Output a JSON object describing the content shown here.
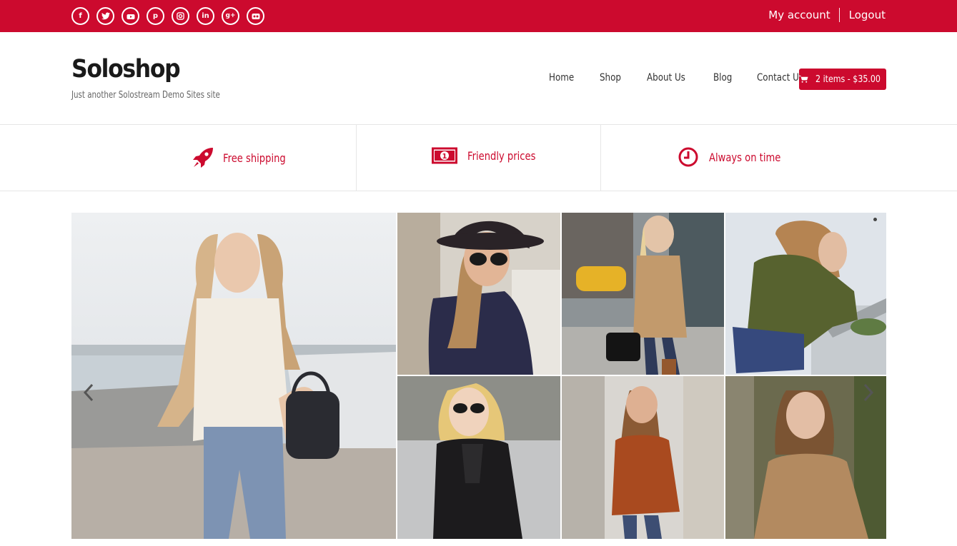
{
  "topbar": {
    "social_icons": [
      "facebook-icon",
      "twitter-icon",
      "youtube-icon",
      "pinterest-icon",
      "instagram-icon",
      "linkedin-icon",
      "google-plus-icon",
      "flickr-icon"
    ],
    "my_account": "My account",
    "logout": "Logout"
  },
  "brand": {
    "title": "Soloshop",
    "tagline": "Just another Solostream Demo Sites site"
  },
  "nav": {
    "items": [
      "Home",
      "Shop",
      "About Us",
      "Blog",
      "Contact Us"
    ]
  },
  "cart": {
    "label": "2 items - $35.00",
    "icon": "cart-icon"
  },
  "features": [
    {
      "icon": "rocket-icon",
      "label": "Free shipping"
    },
    {
      "icon": "money-icon",
      "label": "Friendly prices"
    },
    {
      "icon": "clock-icon",
      "label": "Always on time"
    }
  ],
  "gallery": {
    "slides": [
      "woman-lace-top-photo",
      "woman-black-hat-photo",
      "woman-camel-coat-photo",
      "woman-green-jacket-photo",
      "woman-leather-jacket-photo",
      "woman-rust-jacket-photo",
      "woman-tan-sweater-photo"
    ],
    "prev_icon": "chevron-left-icon",
    "next_icon": "chevron-right-icon"
  },
  "colors": {
    "accent": "#cc0a2e",
    "text": "#222222",
    "muted": "#666666"
  }
}
